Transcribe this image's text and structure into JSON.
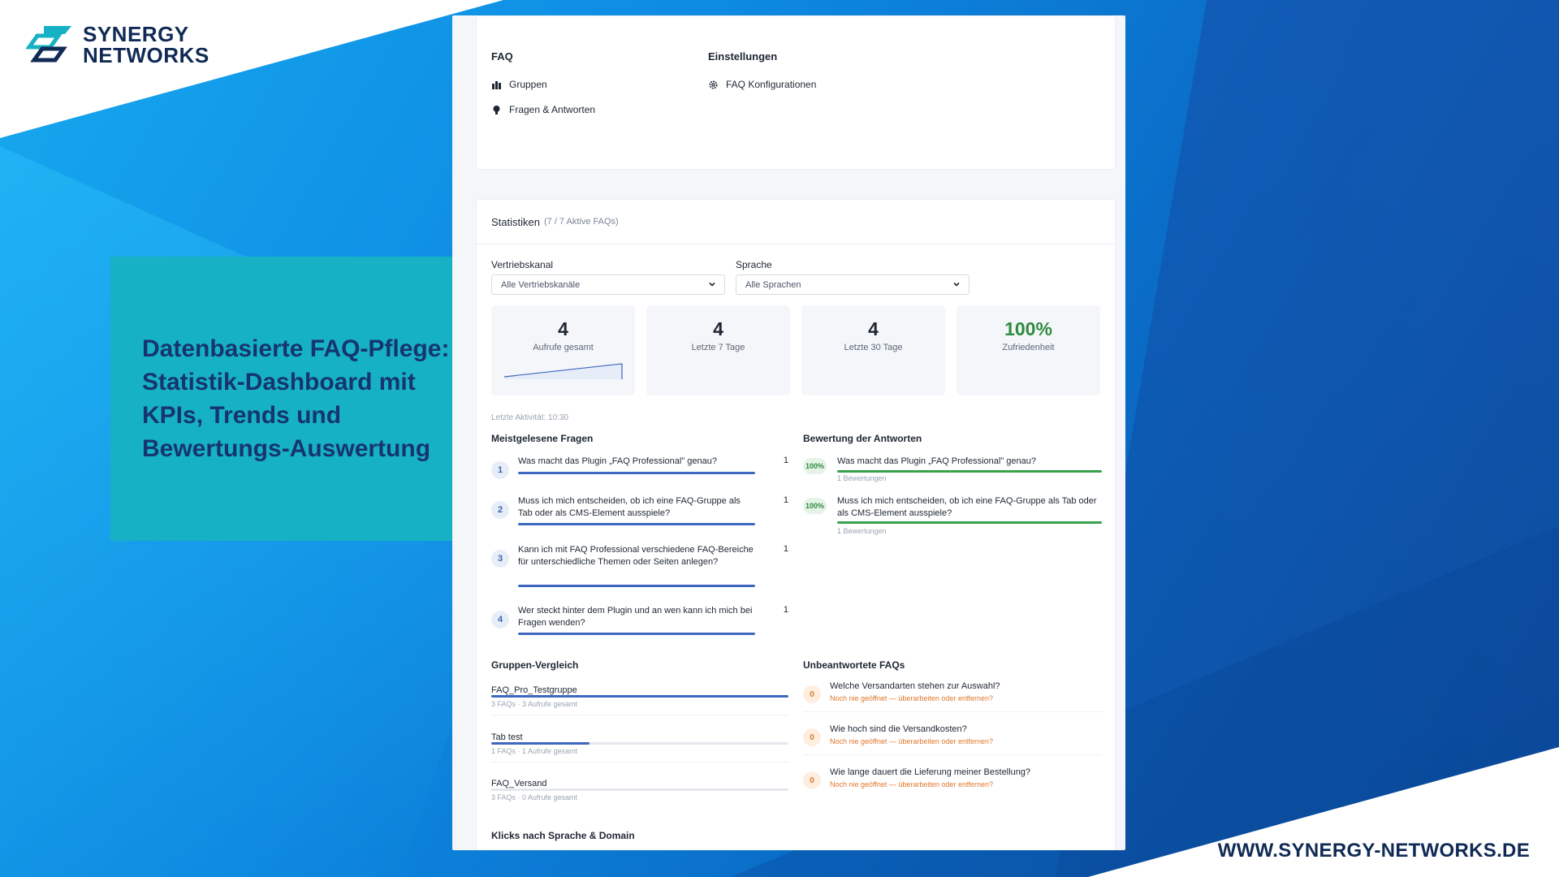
{
  "brand": {
    "name_line1": "SYNERGY",
    "name_line2": "NETWORKS",
    "url": "WWW.SYNERGY-NETWORKS.DE",
    "primary_color": "#102a55",
    "accent_color": "#16b1c4"
  },
  "headline": "Datenbasierte FAQ-Pflege: Statistik-Dashboard mit KPIs, Trends und Bewertungs-Auswertung",
  "nav": {
    "faq_title": "FAQ",
    "faq_items": [
      {
        "label": "Gruppen",
        "icon": "bar-chart-icon"
      },
      {
        "label": "Fragen & Antworten",
        "icon": "lightbulb-icon"
      }
    ],
    "settings_title": "Einstellungen",
    "settings_items": [
      {
        "label": "FAQ Konfigurationen",
        "icon": "gear-icon"
      }
    ]
  },
  "stats": {
    "title": "Statistiken",
    "subtitle": "(7 / 7 Aktive FAQs)",
    "channel_label": "Vertriebskanal",
    "channel_value": "Alle Vertriebskanäle",
    "language_label": "Sprache",
    "language_value": "Alle Sprachen",
    "kpis": [
      {
        "value": "4",
        "label": "Aufrufe gesamt"
      },
      {
        "value": "4",
        "label": "Letzte 7 Tage"
      },
      {
        "value": "4",
        "label": "Letzte 30 Tage"
      },
      {
        "value": "100%",
        "label": "Zufriedenheit"
      }
    ],
    "last_activity": "Letzte Aktivität: 10:30"
  },
  "most_read": {
    "title": "Meistgelesene Fragen",
    "items": [
      {
        "rank": "1",
        "text": "Was macht das Plugin „FAQ Professional\" genau?",
        "count": "1",
        "share": 1.0
      },
      {
        "rank": "2",
        "text": "Muss ich mich entscheiden, ob ich eine FAQ-Gruppe als Tab oder als CMS-Element ausspiele?",
        "count": "1",
        "share": 1.0
      },
      {
        "rank": "3",
        "text": "Kann ich mit FAQ Professional verschiedene FAQ-Bereiche für unterschiedliche Themen oder Seiten anlegen?",
        "count": "1",
        "share": 1.0
      },
      {
        "rank": "4",
        "text": "Wer steckt hinter dem Plugin und an wen kann ich mich bei Fragen wenden?",
        "count": "1",
        "share": 1.0
      }
    ]
  },
  "ratings": {
    "title": "Bewertung der Antworten",
    "items": [
      {
        "percent": "100%",
        "text": "Was macht das Plugin „FAQ Professional\" genau?",
        "sub": "1 Bewertungen",
        "share": 1.0
      },
      {
        "percent": "100%",
        "text": "Muss ich mich entscheiden, ob ich eine FAQ-Gruppe als Tab oder als CMS-Element ausspiele?",
        "sub": "1 Bewertungen",
        "share": 1.0
      }
    ]
  },
  "groups": {
    "title": "Gruppen-Vergleich",
    "items": [
      {
        "name": "FAQ_Pro_Testgruppe",
        "sub": "3 FAQs · 3 Aufrufe gesamt",
        "share": 1.0
      },
      {
        "name": "Tab test",
        "sub": "1 FAQs · 1 Aufrufe gesamt",
        "share": 0.33
      },
      {
        "name": "FAQ_Versand",
        "sub": "3 FAQs · 0 Aufrufe gesamt",
        "share": 0.0
      }
    ]
  },
  "unanswered": {
    "title": "Unbeantwortete FAQs",
    "items": [
      {
        "count": "0",
        "text": "Welche Versandarten stehen zur Auswahl?",
        "sub": "Noch nie geöffnet — überarbeiten oder entfernen?"
      },
      {
        "count": "0",
        "text": "Wie hoch sind die Versandkosten?",
        "sub": "Noch nie geöffnet — überarbeiten oder entfernen?"
      },
      {
        "count": "0",
        "text": "Wie lange dauert die Lieferung meiner Bestellung?",
        "sub": "Noch nie geöffnet — überarbeiten oder entfernen?"
      }
    ]
  },
  "clicks_title": "Klicks nach Sprache & Domain"
}
